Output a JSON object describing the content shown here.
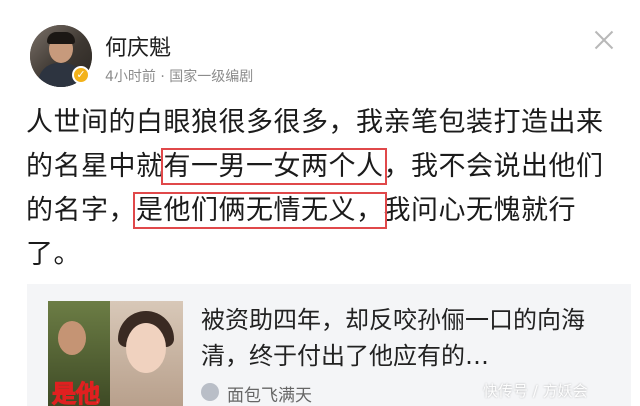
{
  "header": {
    "author": "何庆魁",
    "verified_badge": "✓",
    "time_ago": "4小时前",
    "separator": " · ",
    "author_title": "国家一级编剧"
  },
  "post": {
    "seg1": "人世间的白眼狼很多很多，我亲笔包装打造出来的名星中就",
    "hl1": "有一男一女两个人",
    "seg2": "，我不会说出他们的名字，",
    "hl2": "是他们俩无情无义，",
    "seg3": "我问心无愧就行了。"
  },
  "card": {
    "thumb_caption": "是他",
    "title": "被资助四年，却反咬孙俪一口的向海清，终于付出了他应有的…",
    "source": "面包飞满天"
  },
  "watermark": "快传号 / 方妖会",
  "colors": {
    "highlight_border": "#e0484a",
    "badge": "#f3b21a"
  },
  "icons": {
    "close": "close-icon",
    "verified": "verified-badge-icon"
  }
}
